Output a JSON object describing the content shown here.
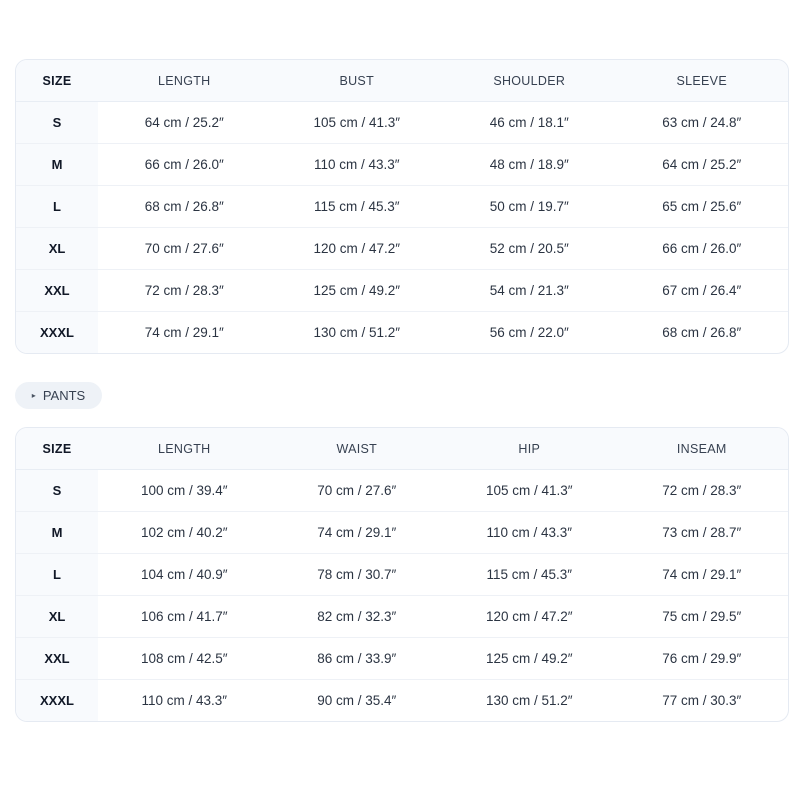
{
  "tops": {
    "headers": [
      "SIZE",
      "LENGTH",
      "BUST",
      "SHOULDER",
      "SLEEVE"
    ],
    "rows": [
      [
        "S",
        "64 cm / 25.2″",
        "105 cm / 41.3″",
        "46 cm / 18.1″",
        "63 cm / 24.8″"
      ],
      [
        "M",
        "66 cm / 26.0″",
        "110 cm / 43.3″",
        "48 cm / 18.9″",
        "64 cm / 25.2″"
      ],
      [
        "L",
        "68 cm / 26.8″",
        "115 cm / 45.3″",
        "50 cm / 19.7″",
        "65 cm / 25.6″"
      ],
      [
        "XL",
        "70 cm / 27.6″",
        "120 cm / 47.2″",
        "52 cm / 20.5″",
        "66 cm / 26.0″"
      ],
      [
        "XXL",
        "72 cm / 28.3″",
        "125 cm / 49.2″",
        "54 cm / 21.3″",
        "67 cm / 26.4″"
      ],
      [
        "XXXL",
        "74 cm / 29.1″",
        "130 cm / 51.2″",
        "56 cm / 22.0″",
        "68 cm / 26.8″"
      ]
    ]
  },
  "pants_section": {
    "caret_icon": "triangle-right-icon",
    "caret_glyph": "▸",
    "label": "PANTS"
  },
  "pants": {
    "headers": [
      "SIZE",
      "LENGTH",
      "WAIST",
      "HIP",
      "INSEAM"
    ],
    "rows": [
      [
        "S",
        "100 cm / 39.4″",
        "70 cm / 27.6″",
        "105 cm / 41.3″",
        "72 cm / 28.3″"
      ],
      [
        "M",
        "102 cm / 40.2″",
        "74 cm / 29.1″",
        "110 cm / 43.3″",
        "73 cm / 28.7″"
      ],
      [
        "L",
        "104 cm / 40.9″",
        "78 cm / 30.7″",
        "115 cm / 45.3″",
        "74 cm / 29.1″"
      ],
      [
        "XL",
        "106 cm / 41.7″",
        "82 cm / 32.3″",
        "120 cm / 47.2″",
        "75 cm / 29.5″"
      ],
      [
        "XXL",
        "108 cm / 42.5″",
        "86 cm / 33.9″",
        "125 cm / 49.2″",
        "76 cm / 29.9″"
      ],
      [
        "XXXL",
        "110 cm / 43.3″",
        "90 cm / 35.4″",
        "130 cm / 51.2″",
        "77 cm / 30.3″"
      ]
    ]
  }
}
